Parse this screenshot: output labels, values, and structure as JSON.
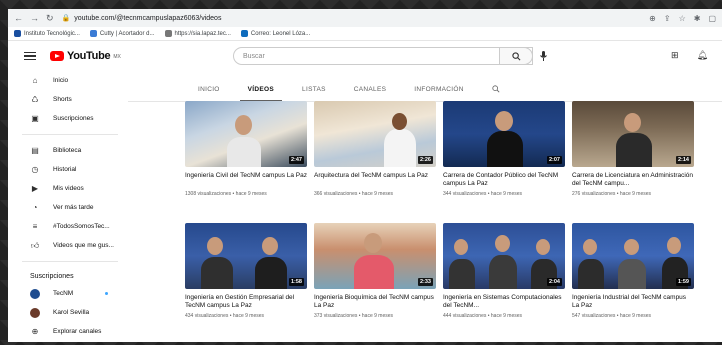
{
  "browser": {
    "url": "youtube.com/@tecnmcampuslapaz6063/videos",
    "bookmarks": [
      "Instituto Tecnológic...",
      "Cutty | Acortador d...",
      "https://sia.lapaz.tec...",
      "Correo: Leonel Lóza..."
    ]
  },
  "youtube": {
    "logo_text": "YouTube",
    "logo_country": "MX",
    "search_placeholder": "Buscar"
  },
  "sidebar": {
    "items": [
      {
        "label": "Inicio",
        "icon": "home-icon"
      },
      {
        "label": "Shorts",
        "icon": "shorts-icon"
      },
      {
        "label": "Suscripciones",
        "icon": "subscriptions-icon"
      }
    ],
    "library": [
      {
        "label": "Biblioteca",
        "icon": "library-icon"
      },
      {
        "label": "Historial",
        "icon": "history-icon"
      },
      {
        "label": "Mis videos",
        "icon": "my-videos-icon"
      },
      {
        "label": "Ver más tarde",
        "icon": "watch-later-icon"
      },
      {
        "label": "#TodosSomosTec...",
        "icon": "playlist-icon"
      },
      {
        "label": "Videos que me gus...",
        "icon": "like-icon"
      }
    ],
    "subs_title": "Suscripciones",
    "subs": [
      {
        "label": "TecNM",
        "color": "#1f4c8f",
        "new": true
      },
      {
        "label": "Karol Sevilla",
        "color": "#6a3a2a",
        "new": false
      },
      {
        "label": "Explorar canales",
        "color": "",
        "new": false
      }
    ]
  },
  "tabs": [
    "INICIO",
    "VÍDEOS",
    "LISTAS",
    "CANALES",
    "INFORMACIÓN"
  ],
  "active_tab": "VÍDEOS",
  "videos": [
    {
      "title": "Ingeniería Civil del TecNM campus La Paz",
      "meta": "1308 visualizaciones • hace 9 meses",
      "duration": "2:47"
    },
    {
      "title": "Arquitectura del TecNM campus La Paz",
      "meta": "366 visualizaciones • hace 9 meses",
      "duration": "2:26"
    },
    {
      "title": "Carrera de Contador Público del TecNM campus La Paz",
      "meta": "344 visualizaciones • hace 9 meses",
      "duration": "2:07"
    },
    {
      "title": "Carrera de Licenciatura en Administración del TecNM campu...",
      "meta": "276 visualizaciones • hace 9 meses",
      "duration": "2:14"
    },
    {
      "title": "Ingeniería en Gestión Empresarial del TecNM campus La Paz",
      "meta": "434 visualizaciones • hace 9 meses",
      "duration": "1:58"
    },
    {
      "title": "Ingeniería Bioquímica del TecNM campus La Paz",
      "meta": "373 visualizaciones • hace 9 meses",
      "duration": "2:33"
    },
    {
      "title": "Ingeniería en Sistemas Computacionales del TecNM...",
      "meta": "444 visualizaciones • hace 9 meses",
      "duration": "2:04"
    },
    {
      "title": "Ingeniería Industrial del TecNM campus La Paz",
      "meta": "547 visualizaciones • hace 9 meses",
      "duration": "1:59"
    }
  ]
}
